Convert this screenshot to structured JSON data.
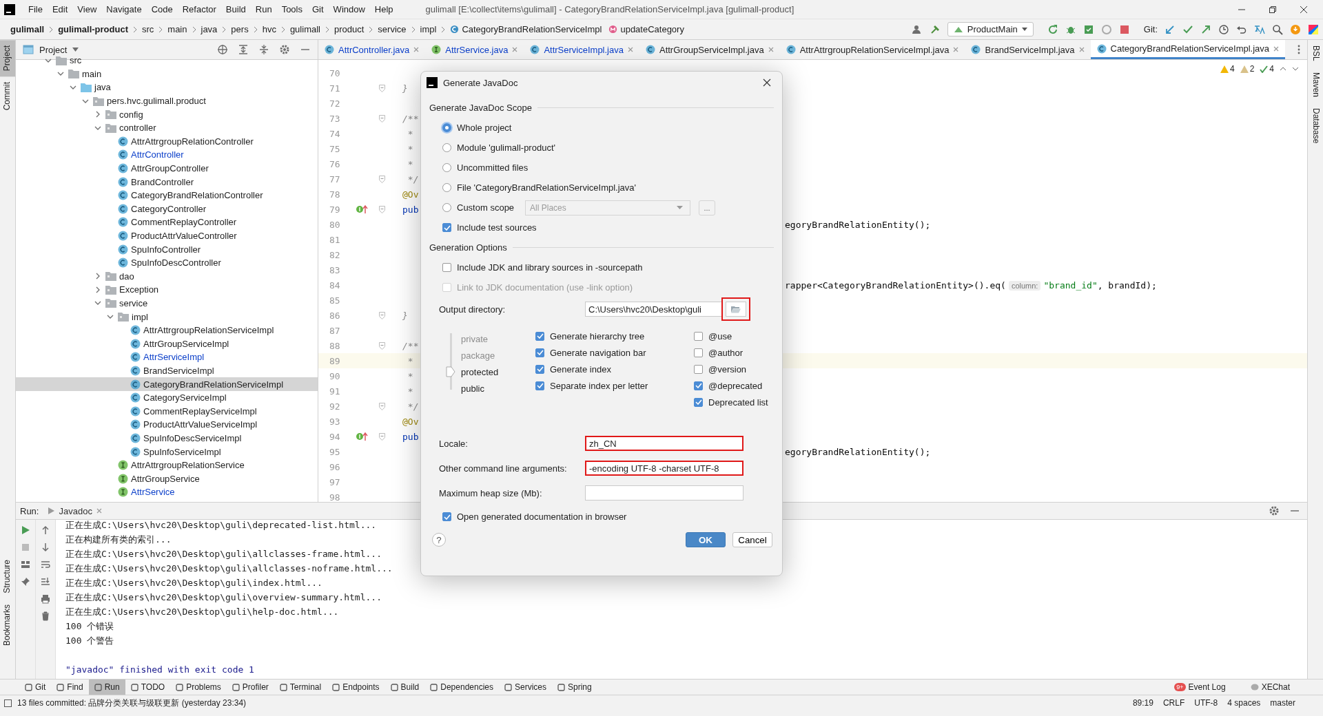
{
  "window": {
    "title": "gulimall [E:\\collect\\items\\gulimall] - CategoryBrandRelationServiceImpl.java [gulimall-product]"
  },
  "menu": [
    "File",
    "Edit",
    "View",
    "Navigate",
    "Code",
    "Refactor",
    "Build",
    "Run",
    "Tools",
    "Git",
    "Window",
    "Help"
  ],
  "breadcrumb": [
    {
      "label": "gulimall",
      "kind": "project"
    },
    {
      "label": "gulimall-product",
      "kind": "module"
    },
    {
      "label": "src",
      "kind": "folder"
    },
    {
      "label": "main",
      "kind": "folder"
    },
    {
      "label": "java",
      "kind": "folder"
    },
    {
      "label": "pers",
      "kind": "folder"
    },
    {
      "label": "hvc",
      "kind": "folder"
    },
    {
      "label": "gulimall",
      "kind": "folder"
    },
    {
      "label": "product",
      "kind": "folder"
    },
    {
      "label": "service",
      "kind": "folder"
    },
    {
      "label": "impl",
      "kind": "folder"
    },
    {
      "label": "CategoryBrandRelationServiceImpl",
      "kind": "class"
    },
    {
      "label": "updateCategory",
      "kind": "method"
    }
  ],
  "toolbar": {
    "run_config": "ProductMain",
    "vcs_label": "Git:"
  },
  "left_stripe": [
    {
      "label": "Project",
      "selected": true
    },
    {
      "label": "Commit",
      "selected": false
    }
  ],
  "left_stripe_bottom": [
    {
      "label": "Structure",
      "selected": false
    },
    {
      "label": "Bookmarks",
      "selected": false
    }
  ],
  "right_stripe": [
    "BSL",
    "Maven",
    "Database"
  ],
  "project": {
    "title": "Project",
    "tree": [
      {
        "label": "src",
        "kind": "folder",
        "expanded": true,
        "selected": false,
        "modified": false,
        "children": [
          {
            "label": "main",
            "kind": "folder",
            "expanded": true,
            "selected": false,
            "modified": false,
            "children": [
              {
                "label": "java",
                "kind": "source",
                "expanded": true,
                "selected": false,
                "modified": false,
                "children": [
                  {
                    "label": "pers.hvc.gulimall.product",
                    "kind": "package",
                    "expanded": true,
                    "selected": false,
                    "modified": false,
                    "children": [
                      {
                        "label": "config",
                        "kind": "package",
                        "expanded": false,
                        "selected": false,
                        "modified": false
                      },
                      {
                        "label": "controller",
                        "kind": "package",
                        "expanded": true,
                        "selected": false,
                        "modified": false,
                        "children": [
                          {
                            "label": "AttrAttrgroupRelationController",
                            "kind": "class",
                            "selected": false,
                            "modified": false
                          },
                          {
                            "label": "AttrController",
                            "kind": "class",
                            "selected": false,
                            "modified": true
                          },
                          {
                            "label": "AttrGroupController",
                            "kind": "class",
                            "selected": false,
                            "modified": false
                          },
                          {
                            "label": "BrandController",
                            "kind": "class",
                            "selected": false,
                            "modified": false
                          },
                          {
                            "label": "CategoryBrandRelationController",
                            "kind": "class",
                            "selected": false,
                            "modified": false
                          },
                          {
                            "label": "CategoryController",
                            "kind": "class",
                            "selected": false,
                            "modified": false
                          },
                          {
                            "label": "CommentReplayController",
                            "kind": "class",
                            "selected": false,
                            "modified": false
                          },
                          {
                            "label": "ProductAttrValueController",
                            "kind": "class",
                            "selected": false,
                            "modified": false
                          },
                          {
                            "label": "SpuInfoController",
                            "kind": "class",
                            "selected": false,
                            "modified": false
                          },
                          {
                            "label": "SpuInfoDescController",
                            "kind": "class",
                            "selected": false,
                            "modified": false
                          }
                        ]
                      },
                      {
                        "label": "dao",
                        "kind": "package",
                        "expanded": false,
                        "selected": false,
                        "modified": false
                      },
                      {
                        "label": "Exception",
                        "kind": "package",
                        "expanded": false,
                        "selected": false,
                        "modified": false
                      },
                      {
                        "label": "service",
                        "kind": "package",
                        "expanded": true,
                        "selected": false,
                        "modified": false,
                        "children": [
                          {
                            "label": "impl",
                            "kind": "package",
                            "expanded": true,
                            "selected": false,
                            "modified": false,
                            "children": [
                              {
                                "label": "AttrAttrgroupRelationServiceImpl",
                                "kind": "class",
                                "selected": false,
                                "modified": false
                              },
                              {
                                "label": "AttrGroupServiceImpl",
                                "kind": "class",
                                "selected": false,
                                "modified": false
                              },
                              {
                                "label": "AttrServiceImpl",
                                "kind": "class",
                                "selected": false,
                                "modified": true
                              },
                              {
                                "label": "BrandServiceImpl",
                                "kind": "class",
                                "selected": false,
                                "modified": false
                              },
                              {
                                "label": "CategoryBrandRelationServiceImpl",
                                "kind": "class",
                                "selected": true,
                                "modified": false
                              },
                              {
                                "label": "CategoryServiceImpl",
                                "kind": "class",
                                "selected": false,
                                "modified": false
                              },
                              {
                                "label": "CommentReplayServiceImpl",
                                "kind": "class",
                                "selected": false,
                                "modified": false
                              },
                              {
                                "label": "ProductAttrValueServiceImpl",
                                "kind": "class",
                                "selected": false,
                                "modified": false
                              },
                              {
                                "label": "SpuInfoDescServiceImpl",
                                "kind": "class",
                                "selected": false,
                                "modified": false
                              },
                              {
                                "label": "SpuInfoServiceImpl",
                                "kind": "class",
                                "selected": false,
                                "modified": false
                              }
                            ]
                          },
                          {
                            "label": "AttrAttrgroupRelationService",
                            "kind": "interface",
                            "selected": false,
                            "modified": false
                          },
                          {
                            "label": "AttrGroupService",
                            "kind": "interface",
                            "selected": false,
                            "modified": false
                          },
                          {
                            "label": "AttrService",
                            "kind": "interface",
                            "selected": false,
                            "modified": true
                          }
                        ]
                      }
                    ]
                  }
                ]
              }
            ]
          }
        ]
      }
    ]
  },
  "editor": {
    "tabs": [
      {
        "label": "AttrController.java",
        "kind": "class",
        "selected": false,
        "modified": true
      },
      {
        "label": "AttrService.java",
        "kind": "interface",
        "selected": false,
        "modified": true
      },
      {
        "label": "AttrServiceImpl.java",
        "kind": "class",
        "selected": false,
        "modified": true
      },
      {
        "label": "AttrGroupServiceImpl.java",
        "kind": "class",
        "selected": false,
        "modified": false
      },
      {
        "label": "AttrAttrgroupRelationServiceImpl.java",
        "kind": "class",
        "selected": false,
        "modified": false
      },
      {
        "label": "BrandServiceImpl.java",
        "kind": "class",
        "selected": false,
        "modified": false
      },
      {
        "label": "CategoryBrandRelationServiceImpl.java",
        "kind": "class",
        "selected": true,
        "modified": false
      }
    ],
    "inspections": [
      {
        "kind": "warning",
        "count": "4"
      },
      {
        "kind": "weak",
        "count": "2"
      },
      {
        "kind": "ok",
        "count": "4"
      }
    ],
    "lines": [
      {
        "number": "70",
        "current": false,
        "override": false,
        "fold": false
      },
      {
        "number": "71",
        "code": "}",
        "current": false,
        "override": false,
        "fold": true
      },
      {
        "number": "72",
        "current": false,
        "override": false,
        "fold": false
      },
      {
        "number": "73",
        "code": "/**",
        "current": false,
        "override": false,
        "fold": true
      },
      {
        "number": "74",
        "code": " *",
        "current": false,
        "override": false,
        "fold": false
      },
      {
        "number": "75",
        "code": " *",
        "current": false,
        "override": false,
        "fold": false
      },
      {
        "number": "76",
        "code": " *",
        "current": false,
        "override": false,
        "fold": false
      },
      {
        "number": "77",
        "code": " */",
        "current": false,
        "override": false,
        "fold": true
      },
      {
        "number": "78",
        "code": "@Ov",
        "kind": "annotation",
        "current": false,
        "override": false,
        "fold": false
      },
      {
        "number": "79",
        "code": "pub",
        "kind": "keyword",
        "current": false,
        "override": true,
        "fold": true
      },
      {
        "number": "80",
        "current": false,
        "override": false,
        "fold": false,
        "tail": [
          {
            "text": "egoryBrandRelationEntity();",
            "kind": "code"
          }
        ]
      },
      {
        "number": "81",
        "current": false,
        "override": false,
        "fold": false
      },
      {
        "number": "82",
        "current": false,
        "override": false,
        "fold": false
      },
      {
        "number": "83",
        "current": false,
        "override": false,
        "fold": false
      },
      {
        "number": "84",
        "current": false,
        "override": false,
        "fold": false,
        "tail": [
          {
            "text": "rapper<CategoryBrandRelationEntity>().eq(",
            "kind": "code"
          },
          {
            "text": "column:",
            "kind": "hint"
          },
          {
            "text": "\"brand_id\"",
            "kind": "string"
          },
          {
            "text": ", brandId);",
            "kind": "code"
          }
        ]
      },
      {
        "number": "85",
        "current": false,
        "override": false,
        "fold": false
      },
      {
        "number": "86",
        "code": "}",
        "current": false,
        "override": false,
        "fold": true
      },
      {
        "number": "87",
        "current": false,
        "override": false,
        "fold": false
      },
      {
        "number": "88",
        "code": "/**",
        "current": false,
        "override": false,
        "fold": true
      },
      {
        "number": "89",
        "code": " *",
        "current": true,
        "override": false,
        "fold": false
      },
      {
        "number": "90",
        "code": " *",
        "current": false,
        "override": false,
        "fold": false
      },
      {
        "number": "91",
        "code": " *",
        "current": false,
        "override": false,
        "fold": false
      },
      {
        "number": "92",
        "code": " */",
        "current": false,
        "override": false,
        "fold": true
      },
      {
        "number": "93",
        "code": "@Ov",
        "kind": "annotation",
        "current": false,
        "override": false,
        "fold": false
      },
      {
        "number": "94",
        "code": "pub",
        "kind": "keyword",
        "current": false,
        "override": true,
        "fold": true
      },
      {
        "number": "95",
        "current": false,
        "override": false,
        "fold": false,
        "tail": [
          {
            "text": "egoryBrandRelationEntity();",
            "kind": "code"
          }
        ]
      },
      {
        "number": "96",
        "current": false,
        "override": false,
        "fold": false
      },
      {
        "number": "97",
        "current": false,
        "override": false,
        "fold": false
      },
      {
        "number": "98",
        "current": false,
        "override": false,
        "fold": false
      }
    ]
  },
  "dialog": {
    "title": "Generate JavaDoc",
    "scope_heading": "Generate JavaDoc Scope",
    "scopes": [
      {
        "label": "Whole project",
        "selected": true
      },
      {
        "label": "Module 'gulimall-product'",
        "selected": false
      },
      {
        "label": "Uncommitted files",
        "selected": false
      },
      {
        "label": "File 'CategoryBrandRelationServiceImpl.java'",
        "selected": false
      },
      {
        "label": "Custom scope",
        "selected": false,
        "dropdown": {
          "value": "All Places",
          "disabled": true,
          "button": "..."
        }
      }
    ],
    "include_tests": {
      "label": "Include test sources",
      "checked": true
    },
    "options_heading": "Generation Options",
    "options": [
      {
        "label": "Include JDK and library sources in -sourcepath",
        "checked": false,
        "disabled": false
      },
      {
        "label": "Link to JDK documentation (use -link option)",
        "checked": false,
        "disabled": true
      }
    ],
    "output": {
      "label": "Output directory:",
      "value": "C:\\Users\\hvc20\\Desktop\\guli",
      "highlighted": true
    },
    "visibility": [
      {
        "label": "private",
        "selected": false
      },
      {
        "label": "package",
        "selected": false
      },
      {
        "label": "protected",
        "selected": true
      },
      {
        "label": "public",
        "selected": false
      }
    ],
    "generate": [
      {
        "label": "Generate hierarchy tree",
        "checked": true
      },
      {
        "label": "Generate navigation bar",
        "checked": true
      },
      {
        "label": "Generate index",
        "checked": true
      },
      {
        "label": "Separate index per letter",
        "checked": true
      }
    ],
    "tags": [
      {
        "label": "@use",
        "checked": false
      },
      {
        "label": "@author",
        "checked": false
      },
      {
        "label": "@version",
        "checked": false
      },
      {
        "label": "@deprecated",
        "checked": true
      },
      {
        "label": "Deprecated list",
        "checked": true
      }
    ],
    "fields": [
      {
        "label": "Locale:",
        "value": "zh_CN",
        "highlighted": true
      },
      {
        "label": "Other command line arguments:",
        "value": "-encoding UTF-8 -charset UTF-8",
        "highlighted": true
      },
      {
        "label": "Maximum heap size (Mb):",
        "highlighted": false
      }
    ],
    "open_browser": {
      "label": "Open generated documentation in browser",
      "checked": true
    },
    "help": "?",
    "ok": "OK",
    "cancel": "Cancel"
  },
  "run": {
    "label": "Run:",
    "tab": "Javadoc",
    "output": [
      {
        "text": "正在生成C:\\Users\\hvc20\\Desktop\\guli\\deprecated-list.html...",
        "kind": "out"
      },
      {
        "text": "正在构建所有类的索引...",
        "kind": "out"
      },
      {
        "text": "正在生成C:\\Users\\hvc20\\Desktop\\guli\\allclasses-frame.html...",
        "kind": "out"
      },
      {
        "text": "正在生成C:\\Users\\hvc20\\Desktop\\guli\\allclasses-noframe.html...",
        "kind": "out"
      },
      {
        "text": "正在生成C:\\Users\\hvc20\\Desktop\\guli\\index.html...",
        "kind": "out"
      },
      {
        "text": "正在生成C:\\Users\\hvc20\\Desktop\\guli\\overview-summary.html...",
        "kind": "out"
      },
      {
        "text": "正在生成C:\\Users\\hvc20\\Desktop\\guli\\help-doc.html...",
        "kind": "out"
      },
      {
        "text": "100 个错误",
        "kind": "out"
      },
      {
        "text": "100 个警告",
        "kind": "out"
      },
      {
        "text": "\"javadoc\" finished with exit code 1",
        "kind": "system"
      }
    ]
  },
  "bottom_tabs": [
    {
      "label": "Git",
      "selected": false
    },
    {
      "label": "Find",
      "selected": false
    },
    {
      "label": "Run",
      "selected": true
    },
    {
      "label": "TODO",
      "selected": false
    },
    {
      "label": "Problems",
      "selected": false
    },
    {
      "label": "Profiler",
      "selected": false
    },
    {
      "label": "Terminal",
      "selected": false
    },
    {
      "label": "Endpoints",
      "selected": false
    },
    {
      "label": "Build",
      "selected": false
    },
    {
      "label": "Dependencies",
      "selected": false
    },
    {
      "label": "Services",
      "selected": false
    },
    {
      "label": "Spring",
      "selected": false
    }
  ],
  "bottom_right_tabs": [
    {
      "label": "Event Log",
      "badge": "9+"
    },
    {
      "label": "XEChat"
    }
  ],
  "status_bar": {
    "message": "13 files committed: 品牌分类关联与级联更新 (yesterday 23:34)",
    "items": [
      "89:19",
      "CRLF",
      "UTF-8",
      "4 spaces",
      "master"
    ]
  }
}
